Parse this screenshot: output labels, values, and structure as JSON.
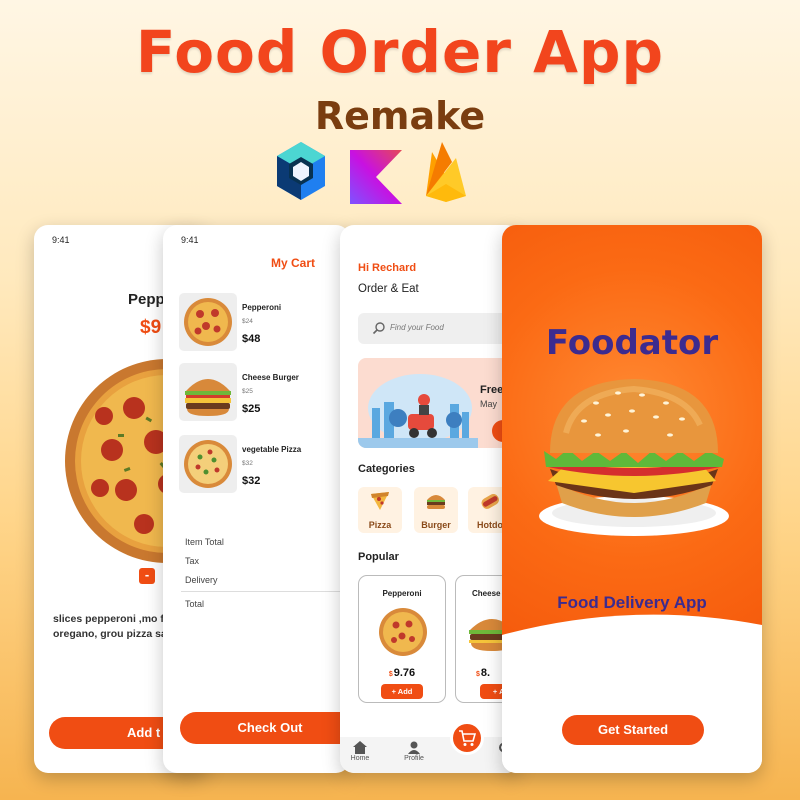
{
  "header": {
    "title": "Food Order App",
    "subtitle": "Remake",
    "logos": [
      {
        "icon": "jetpack-compose-icon"
      },
      {
        "icon": "kotlin-icon"
      },
      {
        "icon": "firebase-icon"
      }
    ]
  },
  "colors": {
    "accent": "#f04d13",
    "brand_text": "#3c2b8f",
    "title": "#f2451d",
    "subtitle": "#7a3d10"
  },
  "detail_screen": {
    "status_time": "9:41",
    "title": "Pepp",
    "price": "$9",
    "qty_minus": "-",
    "description": "slices pepperoni ,mo fresh oregano, grou pizza sauce",
    "add_button": "Add t"
  },
  "cart_screen": {
    "status_time": "9:41",
    "title": "My Cart",
    "items": [
      {
        "name": "Pepperoni",
        "unit": "$24",
        "total": "$48",
        "icon": "pizza-image"
      },
      {
        "name": "Cheese Burger",
        "unit": "$25",
        "total": "$25",
        "icon": "burger-image"
      },
      {
        "name": "vegetable Pizza",
        "unit": "$32",
        "total": "$32",
        "icon": "veg-pizza-image"
      }
    ],
    "summary": {
      "item_total": "Item Total",
      "tax": "Tax",
      "delivery": "Delivery",
      "total": "Total"
    },
    "checkout_button": "Check Out"
  },
  "home_screen": {
    "greeting": "Hi Rechard",
    "subtitle": "Order & Eat",
    "search_placeholder": "Find your Food",
    "banner": {
      "title": "Free",
      "subtitle": "May"
    },
    "categories_title": "Categories",
    "categories": [
      {
        "label": "Pizza",
        "icon": "pizza-slice-icon"
      },
      {
        "label": "Burger",
        "icon": "burger-icon"
      },
      {
        "label": "Hotdo",
        "icon": "hotdog-icon"
      }
    ],
    "popular_title": "Popular",
    "popular": [
      {
        "name": "Pepperoni",
        "currency": "$",
        "price": "9.76",
        "add": "+ Add"
      },
      {
        "name": "Cheese",
        "currency": "$",
        "price": "8.",
        "add": "+ Ad"
      }
    ],
    "nav": [
      {
        "label": "Home",
        "icon": "home-icon"
      },
      {
        "label": "Profile",
        "icon": "profile-icon"
      },
      {
        "label": "S",
        "icon": "settings-icon"
      }
    ]
  },
  "welcome_screen": {
    "brand": "Foodator",
    "tagline": "Food Delivery App",
    "button": "Get Started"
  }
}
